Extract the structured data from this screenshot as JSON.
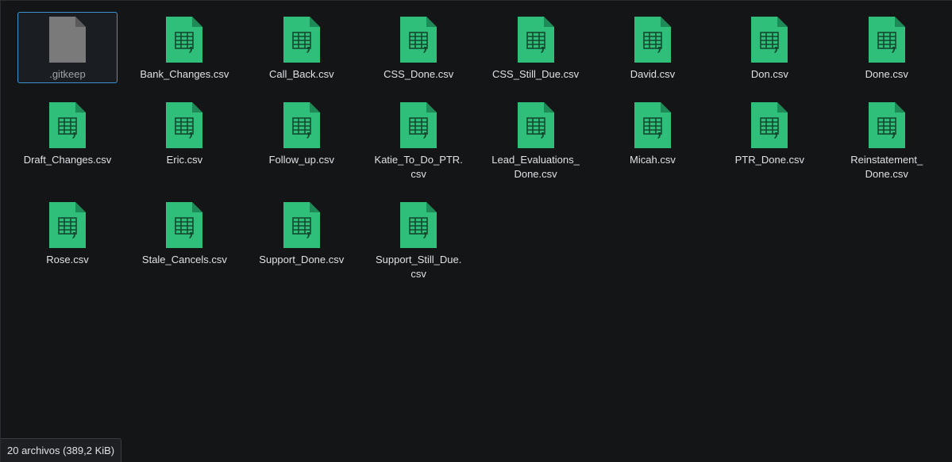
{
  "files": [
    {
      "name": ".gitkeep",
      "type": "generic",
      "selected": true
    },
    {
      "name": "Bank_Changes.csv",
      "type": "csv"
    },
    {
      "name": "Call_Back.csv",
      "type": "csv"
    },
    {
      "name": "CSS_Done.csv",
      "type": "csv"
    },
    {
      "name": "CSS_Still_Due.csv",
      "type": "csv"
    },
    {
      "name": "David.csv",
      "type": "csv"
    },
    {
      "name": "Don.csv",
      "type": "csv"
    },
    {
      "name": "Done.csv",
      "type": "csv"
    },
    {
      "name": "Draft_Changes.csv",
      "type": "csv"
    },
    {
      "name": "Eric.csv",
      "type": "csv"
    },
    {
      "name": "Follow_up.csv",
      "type": "csv"
    },
    {
      "name": "Katie_To_Do_PTR.\ncsv",
      "type": "csv"
    },
    {
      "name": "Lead_Evaluations_\nDone.csv",
      "type": "csv"
    },
    {
      "name": "Micah.csv",
      "type": "csv"
    },
    {
      "name": "PTR_Done.csv",
      "type": "csv"
    },
    {
      "name": "Reinstatement_\nDone.csv",
      "type": "csv"
    },
    {
      "name": "Rose.csv",
      "type": "csv"
    },
    {
      "name": "Stale_Cancels.csv",
      "type": "csv"
    },
    {
      "name": "Support_Done.csv",
      "type": "csv"
    },
    {
      "name": "Support_Still_Due.\ncsv",
      "type": "csv"
    }
  ],
  "icons": {
    "csv": "spreadsheet-file-icon",
    "generic": "generic-file-icon"
  },
  "colors": {
    "csv_body": "#2fbf7b",
    "csv_fold": "#1e8a57",
    "generic_body": "#7a7a7a",
    "generic_fold": "#5a5a5a",
    "selection_border": "#3d95cf"
  },
  "status": {
    "summary": "20 archivos (389,2 KiB)"
  }
}
